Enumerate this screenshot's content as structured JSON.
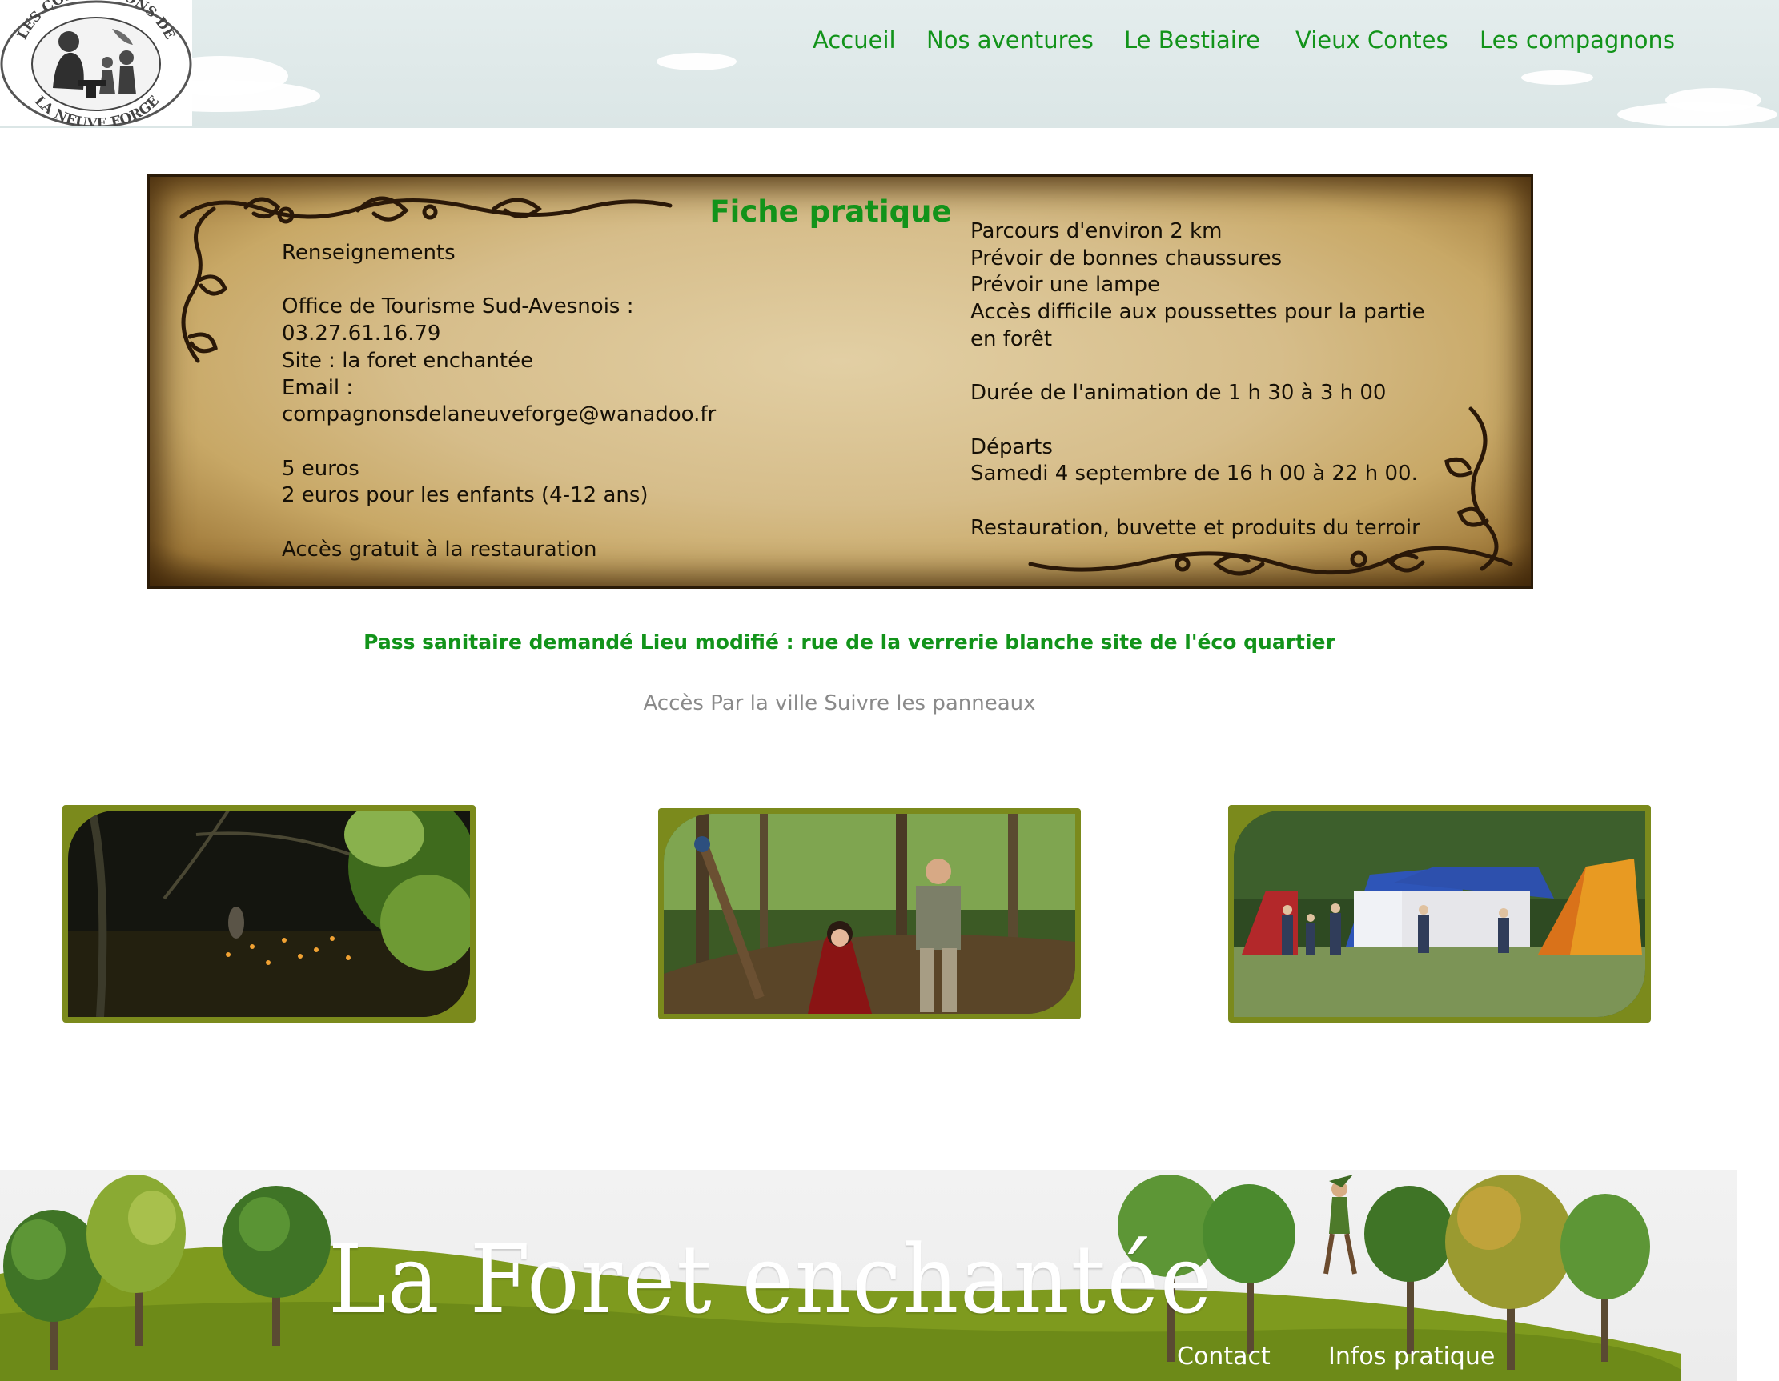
{
  "logo": {
    "text_top": "LES COMPAGNONS DE",
    "text_bottom": "LA NEUVE FORGE"
  },
  "nav": {
    "items": [
      {
        "label": "Accueil"
      },
      {
        "label": "Nos aventures"
      },
      {
        "label": "Le Bestiaire"
      },
      {
        "label": "Vieux Contes"
      },
      {
        "label": "Les compagnons"
      }
    ]
  },
  "fiche": {
    "title": "Fiche pratique",
    "left_lines": [
      "Renseignements",
      "",
      "Office de Tourisme Sud-Avesnois :",
      "03.27.61.16.79",
      "Site : la foret enchantée",
      "Email :",
      "compagnonsdelaneuveforge@wanadoo.fr",
      "",
      "5 euros",
      "2 euros pour les enfants (4-12 ans)",
      "",
      "Accès gratuit à la restauration"
    ],
    "right_lines": [
      "Parcours d'environ 2 km",
      "Prévoir de bonnes chaussures",
      "Prévoir une lampe",
      "Accès difficile aux poussettes pour la partie",
      "en forêt",
      "",
      "Durée de l'animation de 1 h 30 à 3 h 00",
      "",
      "Départs",
      "Samedi 4 septembre de 16 h 00 à 22 h 00.",
      "",
      "Restauration, buvette et produits du terroir"
    ]
  },
  "notices": {
    "green": "Pass sanitaire demandé Lieu modifié : rue de la verrerie blanche site de l'éco quartier",
    "grey": "Accès Par la ville Suivre les panneaux"
  },
  "colors": {
    "accent_green": "#12931a",
    "frame_olive": "#7b8a1c",
    "footer_grass": "#7e9a1e"
  },
  "footer": {
    "title": "La Foret enchantée",
    "links": [
      {
        "label": "Contact"
      },
      {
        "label": "Infos pratique"
      }
    ]
  }
}
